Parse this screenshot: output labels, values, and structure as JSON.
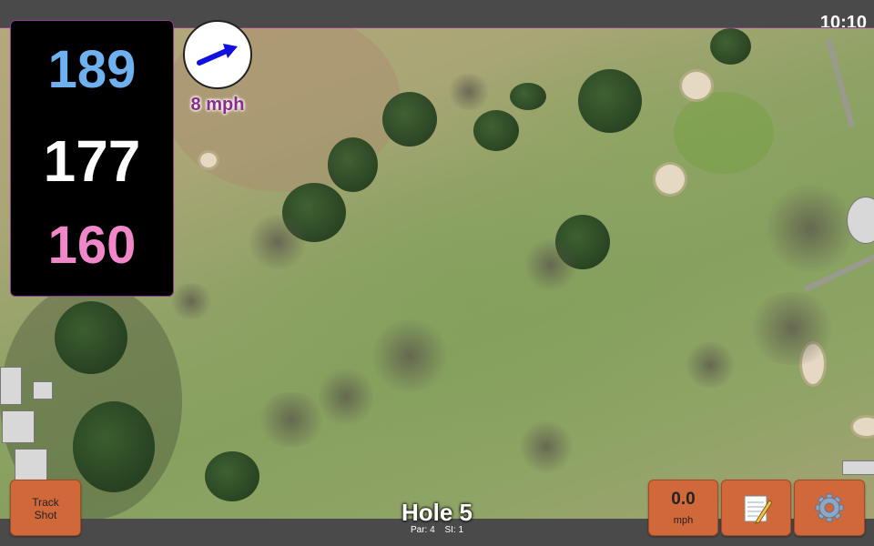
{
  "status_bar": {
    "time": "10:10"
  },
  "distances": {
    "back": "189",
    "middle": "177",
    "front": "160"
  },
  "wind": {
    "speed": "8 mph",
    "icon": "wind-direction-arrow-icon"
  },
  "buttons": {
    "track_shot_line1": "Track",
    "track_shot_line2": "Shot",
    "speed_value": "0.0",
    "speed_unit": "mph",
    "notes_icon": "notepad-icon",
    "settings_icon": "gear-icon"
  },
  "hole": {
    "title": "Hole 5",
    "par": "Par: 4",
    "si": "SI: 1"
  },
  "colors": {
    "back_distance": "#6fb0ee",
    "middle_distance": "#ffffff",
    "front_distance": "#f087c8",
    "button_orange": "#d0683a",
    "wind_arrow": "#1010e0",
    "wind_speed_text": "#8a2d8a"
  }
}
